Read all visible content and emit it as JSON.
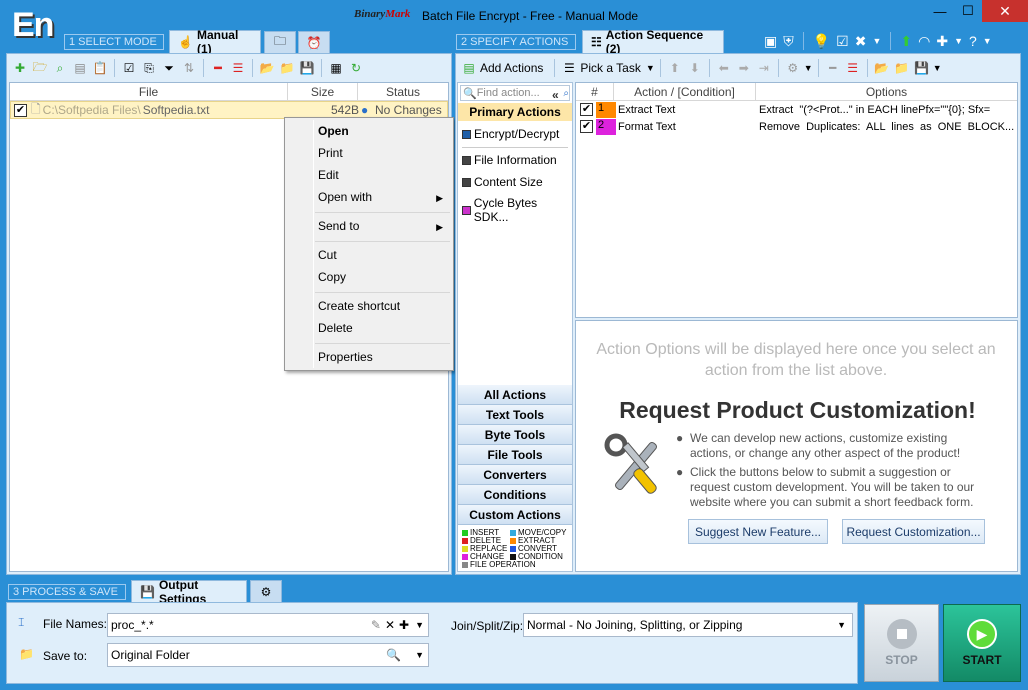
{
  "app": {
    "logo_text": "En",
    "brand_part1": "Binary",
    "brand_part2": "Mark",
    "title": "Batch File Encrypt - Free - Manual Mode",
    "min": "—",
    "max": "☐",
    "close": "✕"
  },
  "mode": {
    "step1": "1  SELECT MODE",
    "tab_manual": "Manual (1)",
    "step2": "2  SPECIFY ACTIONS",
    "tab_sequence": "Action Sequence (2)",
    "step3": "3  PROCESS & SAVE",
    "tab_output": "Output Settings"
  },
  "files": {
    "columns": [
      "File",
      "Size",
      "Status"
    ],
    "rows": [
      {
        "path": "C:\\Softpedia Files\\",
        "name": "Softpedia.txt",
        "size": "542B",
        "status": "No Changes"
      }
    ]
  },
  "context_menu": {
    "items": [
      "Open",
      "Print",
      "Edit",
      "Open with",
      "Send to",
      "Cut",
      "Copy",
      "Create shortcut",
      "Delete",
      "Properties"
    ]
  },
  "actions_panel": {
    "add_actions": "Add Actions",
    "collapse": "«",
    "search_placeholder": "Find action...",
    "primary_header": "Primary Actions",
    "primary_items": [
      {
        "label": "Encrypt/Decrypt",
        "color": "#1f5fa8"
      },
      {
        "label": "File Information",
        "color": "#444444"
      },
      {
        "label": "Content Size",
        "color": "#444444"
      },
      {
        "label": "Cycle Bytes SDK...",
        "color": "#cc33cc"
      }
    ],
    "categories": [
      "All Actions",
      "Text Tools",
      "Byte Tools",
      "File Tools",
      "Converters",
      "Conditions",
      "Custom Actions"
    ],
    "legend": [
      {
        "label": "INSERT",
        "color": "#22cc22"
      },
      {
        "label": "MOVE/COPY",
        "color": "#33aadd"
      },
      {
        "label": "DELETE",
        "color": "#dd2222"
      },
      {
        "label": "EXTRACT",
        "color": "#ff8800"
      },
      {
        "label": "REPLACE",
        "color": "#dddd22"
      },
      {
        "label": "CONVERT",
        "color": "#2255dd"
      },
      {
        "label": "CHANGE",
        "color": "#dd22dd"
      },
      {
        "label": "CONDITION",
        "color": "#111111"
      },
      {
        "label": "FILE OPERATION",
        "color": "#888888"
      }
    ]
  },
  "sequence": {
    "pick_task": "Pick a Task",
    "columns": [
      "#",
      "Action / [Condition]",
      "Options"
    ],
    "rows": [
      {
        "num": "1",
        "color": "#ff8800",
        "action": "Extract Text",
        "options": "Extract  \"(?<Prot...\" in EACH linePfx=\"\"{0}; Sfx="
      },
      {
        "num": "2",
        "color": "#dd22dd",
        "action": "Format Text",
        "options": "Remove  Duplicates:  ALL  lines  as  ONE  BLOCK..."
      }
    ]
  },
  "options_panel": {
    "placeholder": "Action Options will be displayed here once you select an action from the list above.",
    "heading": "Request Product Customization!",
    "bullet1": "We can develop new actions, customize existing actions, or change any other aspect of the product!",
    "bullet2": "Click the buttons below to submit a suggestion or request custom development. You will be taken to our website where you can submit a short feedback form.",
    "btn_suggest": "Suggest New Feature...",
    "btn_request": "Request Customization..."
  },
  "output": {
    "filenames_label": "File Names:",
    "filenames_value": "proc_*.*",
    "saveto_label": "Save to:",
    "saveto_value": "Original Folder",
    "join_label": "Join/Split/Zip:",
    "join_value": "Normal - No Joining, Splitting, or Zipping",
    "stop": "STOP",
    "start": "START"
  },
  "colors": {
    "accent": "#2a8fd6",
    "panel": "#dfeefa",
    "start": "#1fa37a",
    "selected_row": "#fff3c4"
  }
}
